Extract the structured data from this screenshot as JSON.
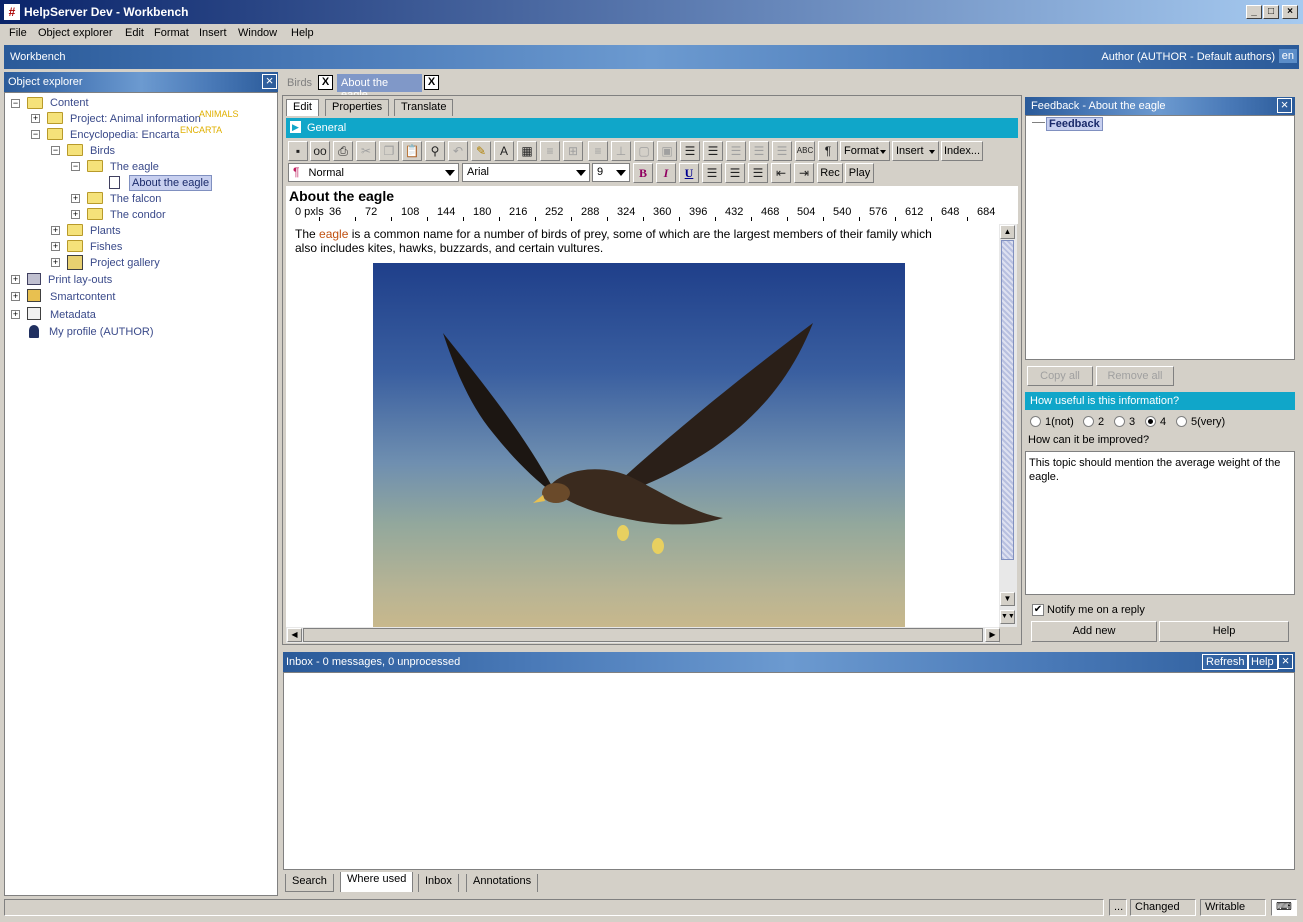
{
  "window": {
    "title": "HelpServer Dev - Workbench"
  },
  "menu": [
    "File",
    "Object explorer",
    "Edit",
    "Format",
    "Insert",
    "Window",
    "Help"
  ],
  "workbench": {
    "title": "Workbench",
    "user": "Author (AUTHOR - Default authors)",
    "lang": "en"
  },
  "explorer": {
    "title": "Object explorer",
    "items": {
      "content": "Content",
      "project": "Project: Animal information",
      "project_tag": "ANIMALS",
      "encyclopedia": "Encyclopedia: Encarta",
      "encyclopedia_tag": "ENCARTA",
      "birds": "Birds",
      "eagle": "The eagle",
      "about": "About the eagle",
      "falcon": "The falcon",
      "condor": "The condor",
      "plants": "Plants",
      "fishes": "Fishes",
      "gallery": "Project gallery",
      "print": "Print lay-outs",
      "smart": "Smartcontent",
      "meta": "Metadata",
      "profile": "My profile (AUTHOR)"
    }
  },
  "doc_tabs": [
    {
      "label": "Birds"
    },
    {
      "label": "About the eagle"
    }
  ],
  "sub_tabs": [
    "Edit",
    "Properties",
    "Translate"
  ],
  "general_label": "General",
  "toolbar": {
    "format": "Format",
    "insert": "Insert",
    "index": "Index...",
    "rec": "Rec",
    "play": "Play"
  },
  "style_combo": "Normal",
  "font_combo": "Arial",
  "size_combo": "9",
  "document": {
    "heading": "About the eagle",
    "ruler": [
      "0 pxls",
      "36",
      "72",
      "108",
      "144",
      "180",
      "216",
      "252",
      "288",
      "324",
      "360",
      "396",
      "432",
      "468",
      "504",
      "540",
      "576",
      "612",
      "648",
      "684"
    ],
    "text_before": "The ",
    "text_link": "eagle",
    "text_after": " is a common name for a number of birds of prey, some of which are the largest members of their family which",
    "text_line2": "also includes kites, hawks, buzzards, and certain vultures."
  },
  "feedback": {
    "title": "Feedback - About the eagle",
    "node": "Feedback",
    "copy_all": "Copy all",
    "remove_all": "Remove all",
    "question": "How useful is this information?",
    "options": [
      "1(not)",
      "2",
      "3",
      "4",
      "5(very)"
    ],
    "selected": "4",
    "improve_label": "How can it be improved?",
    "comment": "This topic should mention the average weight of the eagle.",
    "notify": "Notify me on a reply",
    "add_new": "Add new",
    "help": "Help"
  },
  "inbox": {
    "title": "Inbox - 0 messages, 0 unprocessed",
    "refresh": "Refresh",
    "help": "Help"
  },
  "bottom_tabs": [
    "Search",
    "Where used",
    "Inbox",
    "Annotations"
  ],
  "status": {
    "dots": "...",
    "changed": "Changed",
    "writable": "Writable"
  }
}
